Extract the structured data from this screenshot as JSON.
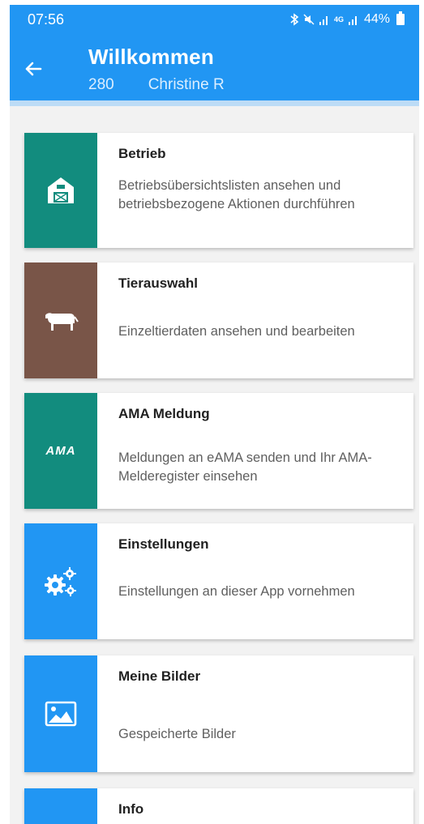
{
  "status_bar": {
    "time": "07:56",
    "icons": [
      "bluetooth-icon",
      "mute-icon",
      "signal-icon",
      "4g-icon",
      "signal-icon"
    ],
    "network_label": "4G",
    "battery": "44%"
  },
  "app_bar": {
    "title": "Willkommen",
    "subtitle_id": "280",
    "subtitle_name": "Christine R",
    "color": "#2196f3"
  },
  "menu": {
    "items": [
      {
        "title": "Betrieb",
        "description": "Betriebsübersichtslisten ansehen und betriebsbezogene Aktionen durchführen",
        "icon": "barn-icon",
        "color": "#128c7e"
      },
      {
        "title": "Tierauswahl",
        "description": "Einzeltierdaten ansehen und bearbeiten",
        "icon": "cow-icon",
        "color": "#795548"
      },
      {
        "title": "AMA Meldung",
        "description": "Meldungen an eAMA senden und Ihr AMA-Melderegister einsehen",
        "icon": "ama-logo-icon",
        "icon_text": "AMA",
        "color": "#128c7e"
      },
      {
        "title": "Einstellungen",
        "description": "Einstellungen an dieser App vornehmen",
        "icon": "gears-icon",
        "color": "#2196f3"
      },
      {
        "title": "Meine Bilder",
        "description": "Gespeicherte Bilder",
        "icon": "image-icon",
        "color": "#2196f3"
      },
      {
        "title": "Info",
        "description": "",
        "icon": "info-icon",
        "color": "#2196f3"
      }
    ]
  }
}
